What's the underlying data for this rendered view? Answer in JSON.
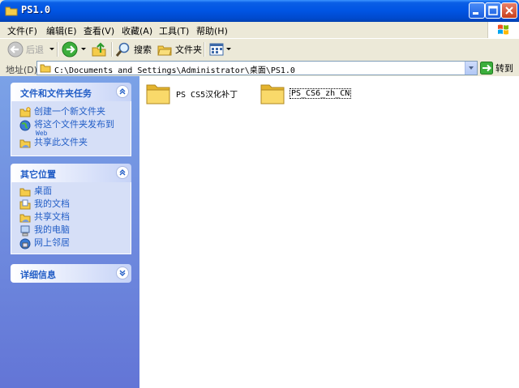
{
  "window": {
    "title": "PS1.0"
  },
  "menu": [
    {
      "label": "文件(F)"
    },
    {
      "label": "编辑(E)"
    },
    {
      "label": "查看(V)"
    },
    {
      "label": "收藏(A)"
    },
    {
      "label": "工具(T)"
    },
    {
      "label": "帮助(H)"
    }
  ],
  "toolbar": {
    "back_label": "后退",
    "search_label": "搜索",
    "folders_label": "文件夹"
  },
  "address": {
    "label": "地址(D)",
    "path": "C:\\Documents and Settings\\Administrator\\桌面\\PS1.0",
    "go_label": "转到"
  },
  "taskpane": {
    "file_tasks": {
      "title": "文件和文件夹任务",
      "items": [
        {
          "label": "创建一个新文件夹"
        },
        {
          "label": "将这个文件夹发布到",
          "sub": "Web"
        },
        {
          "label": "共享此文件夹"
        }
      ]
    },
    "other_places": {
      "title": "其它位置",
      "items": [
        {
          "label": "桌面"
        },
        {
          "label": "我的文档"
        },
        {
          "label": "共享文档"
        },
        {
          "label": "我的电脑"
        },
        {
          "label": "网上邻居"
        }
      ]
    },
    "details": {
      "title": "详细信息"
    }
  },
  "files": [
    {
      "name": "PS CS5汉化补丁"
    },
    {
      "name": "PS_CS6_zh_CN"
    }
  ],
  "colors": {
    "title_bar": "#0054e3",
    "task_link": "#215dc6",
    "pane_bg": "#7ba2e7",
    "folder": "#f5cc4a"
  }
}
